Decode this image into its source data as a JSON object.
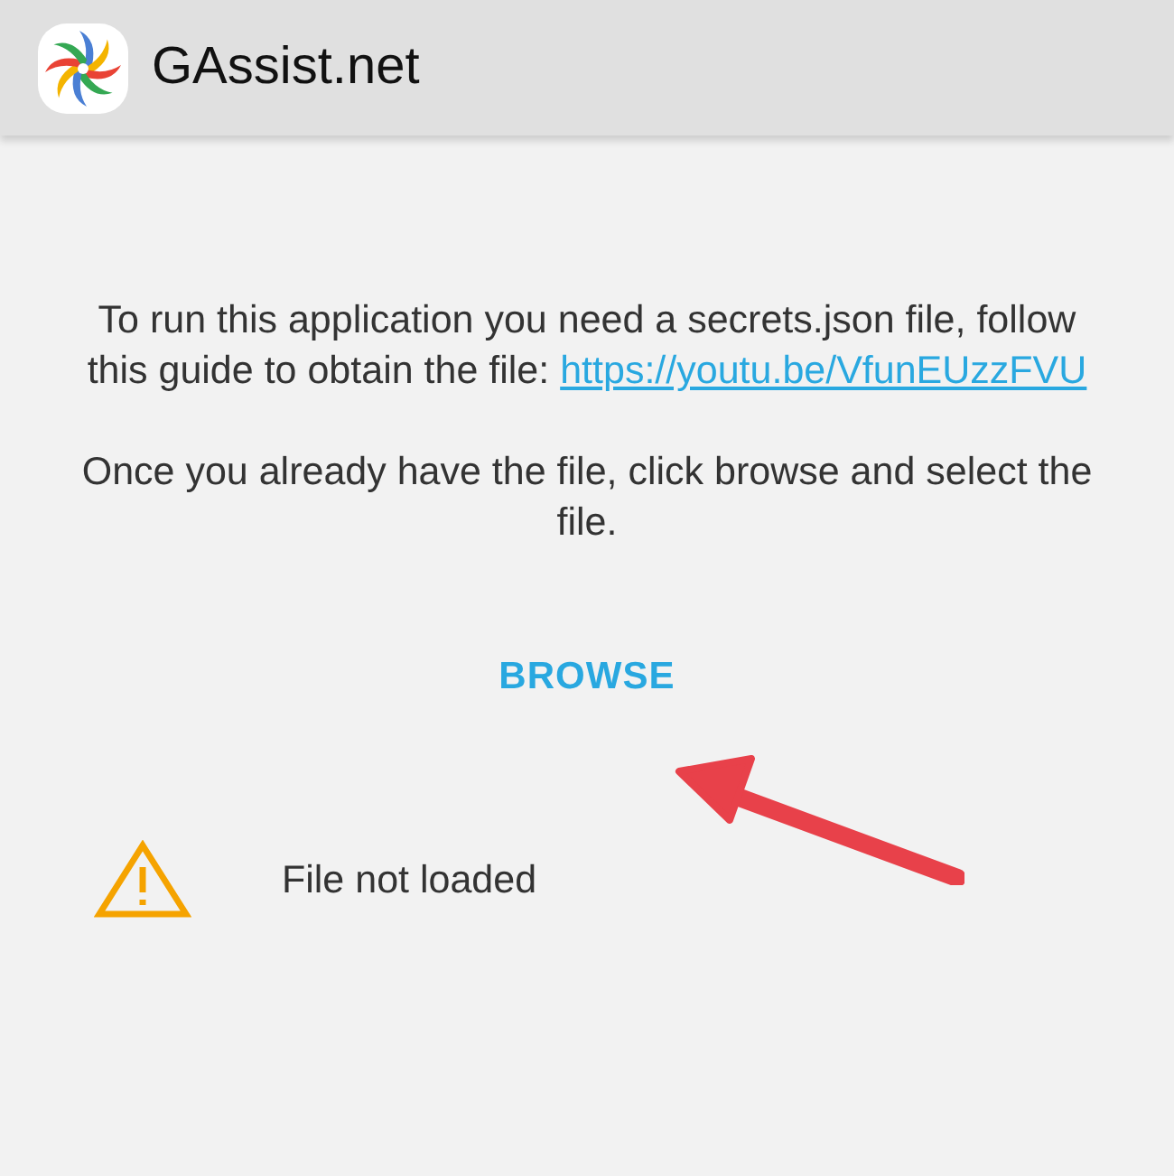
{
  "app_bar": {
    "title": "GAssist.net"
  },
  "instructions": {
    "text": "To run this application you need a secrets.json file, follow this guide to obtain the file:",
    "link": "https://youtu.be/VfunEUzzFVU"
  },
  "hint": "Once you already have the file, click browse and select the file.",
  "browse_button": {
    "label": "BROWSE"
  },
  "status": {
    "kind": "warning",
    "text": "File not loaded"
  }
}
